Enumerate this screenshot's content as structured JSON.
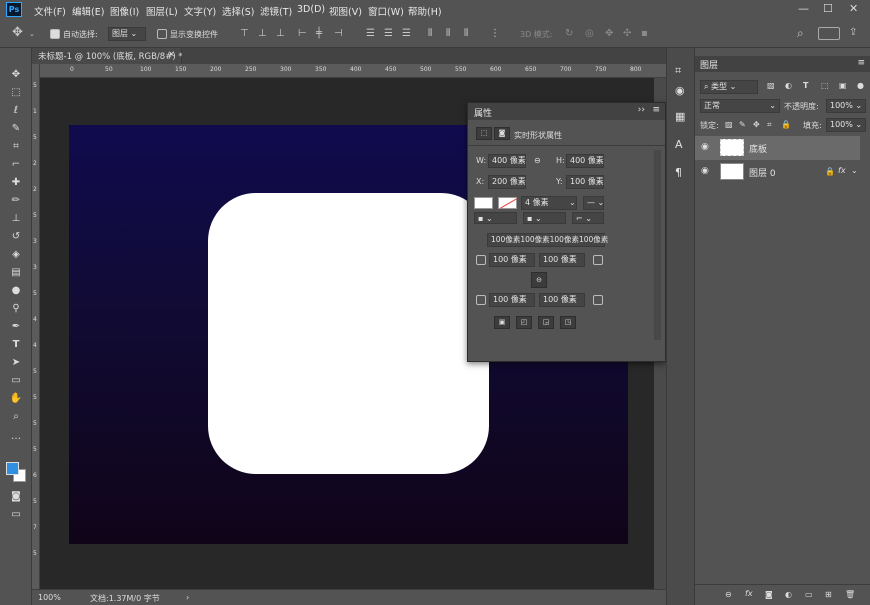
{
  "app": {
    "logo": "Ps"
  },
  "menus": [
    "文件(F)",
    "编辑(E)",
    "图像(I)",
    "图层(L)",
    "文字(Y)",
    "选择(S)",
    "滤镜(T)",
    "3D(D)",
    "视图(V)",
    "窗口(W)",
    "帮助(H)"
  ],
  "window_controls": {
    "minimize": "—",
    "maximize": "☐",
    "close": "✕"
  },
  "options": {
    "auto_select_label": "自动选择:",
    "auto_select_value": "图层",
    "show_transform_label": "显示变换控件",
    "mode_3d_label": "3D 模式:"
  },
  "document": {
    "tab_title": "未标题-1 @ 100% (底板, RGB/8#) *",
    "zoom": "100%",
    "status": "文档:1.37M/0 字节"
  },
  "ruler": {
    "h_ticks": [
      "0",
      "50",
      "100",
      "150",
      "200",
      "250",
      "300",
      "350",
      "400",
      "450",
      "500",
      "550",
      "600",
      "650",
      "700",
      "750",
      "800"
    ],
    "v_ticks": [
      "5",
      "1",
      "5",
      "2",
      "2",
      "5",
      "3",
      "3",
      "5",
      "4",
      "4",
      "5",
      "5",
      "5",
      "5",
      "6",
      "5",
      "7",
      "5"
    ]
  },
  "colors": {
    "fg": "#2f8fe2",
    "bg": "#ffffff",
    "canvas_top": "#100b4d",
    "canvas_bottom": "#100418"
  },
  "properties": {
    "title": "属性",
    "subtitle": "实时形状属性",
    "w_label": "W:",
    "w_value": "400 像素",
    "h_label": "H:",
    "h_value": "400 像素",
    "x_label": "X:",
    "x_value": "200 像素",
    "y_label": "Y:",
    "y_value": "100 像素",
    "stroke_width": "4 像素",
    "corners_summary": "100像素100像素100像素100像素",
    "corner_tl": "100 像素",
    "corner_tr": "100 像素",
    "corner_bl": "100 像素",
    "corner_br": "100 像素"
  },
  "layers_panel": {
    "title": "图层",
    "filter_label": "类型",
    "blend_mode": "正常",
    "opacity_label": "不透明度:",
    "opacity_value": "100%",
    "lock_label": "锁定:",
    "fill_label": "填充:",
    "fill_value": "100%",
    "layers": [
      {
        "name": "底板",
        "selected": true
      },
      {
        "name": "图层 0",
        "selected": false,
        "fx": "fx"
      }
    ]
  }
}
